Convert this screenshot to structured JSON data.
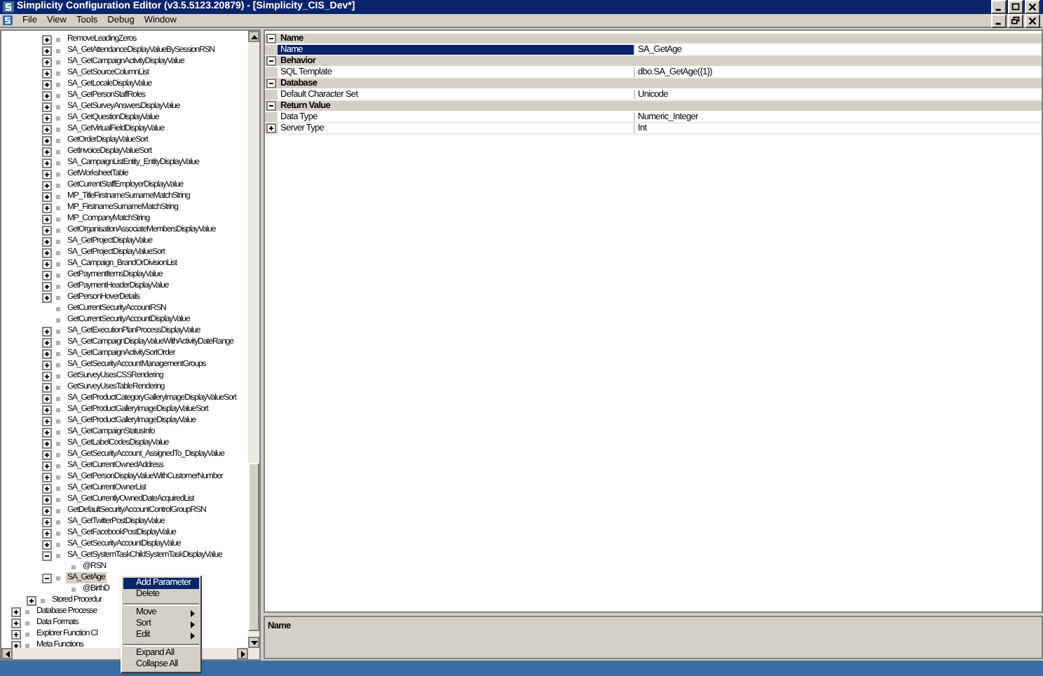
{
  "window": {
    "title": "Simplicity Configuration Editor (v3.5.5123.20879) - [Simplicity_CIS_Dev*]"
  },
  "menu": [
    "File",
    "View",
    "Tools",
    "Debug",
    "Window"
  ],
  "tree": {
    "items": [
      {
        "children": [
          {
            "children": [
              {
                "label": "RemoveLeadingZeros",
                "expanded": false,
                "selected": false
              },
              {
                "label": "SA_GetAttendanceDisplayValueBySessionRSN",
                "expanded": false,
                "selected": false
              },
              {
                "label": "SA_GetCampaignActivityDisplayValue",
                "expanded": false,
                "selected": false
              },
              {
                "label": "SA_GetSourceColumnList",
                "expanded": false,
                "selected": false
              },
              {
                "label": "SA_GetLocaleDisplayValue",
                "expanded": false,
                "selected": false
              },
              {
                "label": "SA_GetPersonStaffRoles",
                "expanded": false,
                "selected": false
              },
              {
                "label": "SA_GetSurveyAnswersDisplayValue",
                "expanded": false,
                "selected": false
              },
              {
                "label": "SA_GetQuestionDisplayValue",
                "expanded": false,
                "selected": false
              },
              {
                "label": "SA_GetVirtualFieldDisplayValue",
                "expanded": false,
                "selected": false
              },
              {
                "label": "GetOrderDisplayValueSort",
                "expanded": false,
                "selected": false
              },
              {
                "label": "GetInvoiceDisplayValueSort",
                "expanded": false,
                "selected": false
              },
              {
                "label": "SA_CampaignListEntity_EntityDisplayValue",
                "expanded": false,
                "selected": false
              },
              {
                "label": "GetWorksheetTable",
                "expanded": false,
                "selected": false
              },
              {
                "label": "GetCurrentStaffEmployerDisplayValue",
                "expanded": false,
                "selected": false
              },
              {
                "label": "MP_TitleFirstnameSurnameMatchString",
                "expanded": false,
                "selected": false
              },
              {
                "label": "MP_FirstnameSurnameMatchString",
                "expanded": false,
                "selected": false
              },
              {
                "label": "MP_CompanyMatchString",
                "expanded": false,
                "selected": false
              },
              {
                "label": "GetOrganisationAssociateMembersDisplayValue",
                "expanded": false,
                "selected": false
              },
              {
                "label": "SA_GetProjectDisplayValue",
                "expanded": false,
                "selected": false
              },
              {
                "label": "SA_GetProjectDisplayValueSort",
                "expanded": false,
                "selected": false
              },
              {
                "label": "SA_Campaign_BrandOrDivisionList",
                "expanded": false,
                "selected": false
              },
              {
                "label": "GetPaymentItemsDisplayValue",
                "expanded": false,
                "selected": false
              },
              {
                "label": "GetPaymentHeaderDisplayValue",
                "expanded": false,
                "selected": false
              },
              {
                "label": "GetPersonHoverDetails",
                "expanded": false,
                "selected": false
              },
              {
                "label": "GetCurrentSecurityAccountRSN",
                "selected": false
              },
              {
                "label": "GetCurrentSecurityAccountDisplayValue",
                "selected": false
              },
              {
                "label": "SA_GetExecutionPlanProcessDisplayValue",
                "expanded": false,
                "selected": false
              },
              {
                "label": "SA_GetCampaignDisplayValueWithActivityDateRange",
                "expanded": false,
                "selected": false
              },
              {
                "label": "SA_GetCampaignActivitySortOrder",
                "expanded": false,
                "selected": false
              },
              {
                "label": "SA_GetSecurityAccountManagementGroups",
                "expanded": false,
                "selected": false
              },
              {
                "label": "GetSurveyUsesCSSRendering",
                "expanded": false,
                "selected": false
              },
              {
                "label": "GetSurveyUsesTableRendering",
                "expanded": false,
                "selected": false
              },
              {
                "label": "SA_GetProductCategoryGalleryImageDisplayValueSort",
                "expanded": false,
                "selected": false
              },
              {
                "label": "SA_GetProductGalleryImageDisplayValueSort",
                "expanded": false,
                "selected": false
              },
              {
                "label": "SA_GetProductGalleryImageDisplayValue",
                "expanded": false,
                "selected": false
              },
              {
                "label": "SA_GetCampaignStatusInfo",
                "expanded": false,
                "selected": false
              },
              {
                "label": "SA_GetLabelCodesDisplayValue",
                "expanded": false,
                "selected": false
              },
              {
                "label": "SA_GetSecurityAccount_AssignedTo_DisplayValue",
                "expanded": false,
                "selected": false
              },
              {
                "label": "SA_GetCurrentOwnedAddress",
                "expanded": false,
                "selected": false
              },
              {
                "label": "SA_GetPersonDisplayValueWithCustomerNumber",
                "expanded": false,
                "selected": false
              },
              {
                "label": "SA_GetCurrentOwnerList",
                "expanded": false,
                "selected": false
              },
              {
                "label": "SA_GetCurrentlyOwnedDateAcquiredList",
                "expanded": false,
                "selected": false
              },
              {
                "label": "GetDefaultSecurityAccountControlGroupRSN",
                "expanded": false,
                "selected": false
              },
              {
                "label": "SA_GetTwitterPostDisplayValue",
                "expanded": false,
                "selected": false
              },
              {
                "label": "SA_GetFacebookPostDisplayValue",
                "expanded": false,
                "selected": false
              },
              {
                "label": "SA_GetSecurityAccountDisplayValue",
                "expanded": false,
                "selected": false
              },
              {
                "label": "SA_GetSystemTaskChildSystemTaskDisplayValue",
                "expanded": true,
                "selected": false,
                "children": [
                  {
                    "label": "@RSN",
                    "selected": false
                  }
                ]
              },
              {
                "label": "SA_GetAge",
                "expanded": true,
                "selected": true,
                "children": [
                  {
                    "label": "@BirthD",
                    "selected": false
                  }
                ]
              }
            ]
          },
          {
            "label": "Stored Procedur",
            "expanded": false,
            "selected": false
          }
        ]
      },
      {
        "label": "Database Processe",
        "expanded": false,
        "selected": false
      },
      {
        "label": "Data Formats",
        "expanded": false,
        "selected": false
      },
      {
        "label": "Explorer Function Cl",
        "expanded": false,
        "selected": false
      },
      {
        "label": "Meta Functions",
        "expanded": false,
        "selected": false
      }
    ]
  },
  "context_menu": [
    {
      "kind": "item",
      "label": "Add Parameter",
      "selected": true,
      "submenu": false
    },
    {
      "kind": "item",
      "label": "Delete",
      "selected": false,
      "submenu": false
    },
    {
      "kind": "separator"
    },
    {
      "kind": "item",
      "label": "Move",
      "selected": false,
      "submenu": true
    },
    {
      "kind": "item",
      "label": "Sort",
      "selected": false,
      "submenu": true
    },
    {
      "kind": "item",
      "label": "Edit",
      "selected": false,
      "submenu": true
    },
    {
      "kind": "separator"
    },
    {
      "kind": "item",
      "label": "Expand All",
      "selected": false,
      "submenu": false
    },
    {
      "kind": "item",
      "label": "Collapse All",
      "selected": false,
      "submenu": false
    }
  ],
  "properties": {
    "categories": [
      {
        "name": "Name",
        "expanded": true,
        "rows": [
          {
            "name": "Name",
            "value": "SA_GetAge",
            "selected": true
          }
        ]
      },
      {
        "name": "Behavior",
        "expanded": true,
        "rows": [
          {
            "name": "SQL Template",
            "value": "dbo.SA_GetAge({1})",
            "selected": false
          }
        ]
      },
      {
        "name": "Database",
        "expanded": true,
        "rows": [
          {
            "name": "Default Character Set",
            "value": "Unicode",
            "selected": false
          }
        ]
      },
      {
        "name": "Return Value",
        "expanded": true,
        "rows": [
          {
            "name": "Data Type",
            "value": "Numeric_Integer",
            "selected": false
          },
          {
            "name": "Server Type",
            "value": "Int",
            "selected": false,
            "expanded": false
          }
        ]
      }
    ]
  },
  "description": {
    "title": "Name"
  }
}
